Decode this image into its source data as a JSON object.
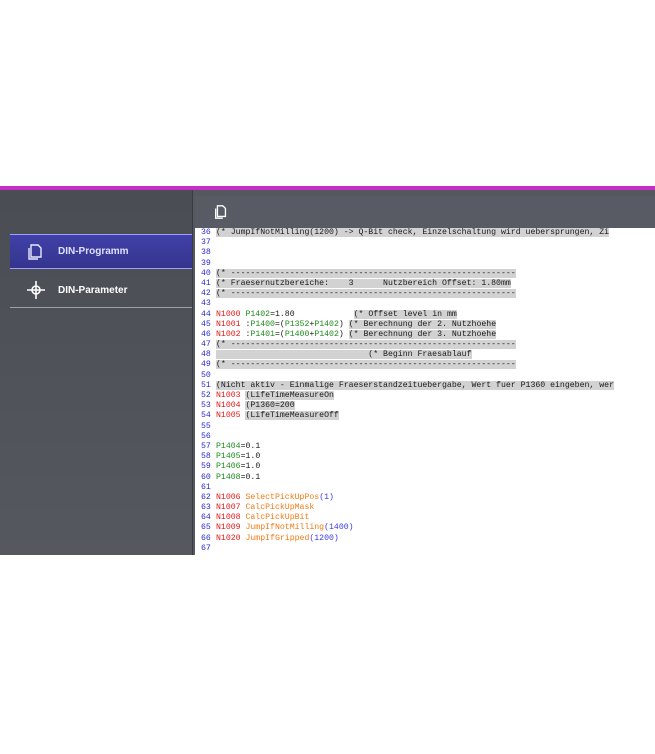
{
  "colors": {
    "accent": "#c62fc6",
    "sidebar_active": "#3b3b9e",
    "red": "#e01919",
    "green": "#1c8c1c",
    "orange": "#f07a12",
    "blue": "#3a3ae0"
  },
  "sidebar": {
    "items": [
      {
        "label": "DIN-Programm",
        "icon": "copy-document-icon",
        "active": true
      },
      {
        "label": "DIN-Parameter",
        "icon": "crosshair-icon",
        "active": false
      }
    ]
  },
  "toolbar": {
    "icon": "copy-document-icon"
  },
  "code": {
    "lines": [
      {
        "n": "36",
        "hl": true,
        "segs": [
          {
            "t": "(* JumpIfNotMilling(1200) -> Q-Bit check, Einzelschaltung wird uebersprungen, Zi"
          }
        ]
      },
      {
        "n": "37",
        "hl": false,
        "segs": []
      },
      {
        "n": "38",
        "hl": false,
        "segs": []
      },
      {
        "n": "39",
        "hl": false,
        "segs": []
      },
      {
        "n": "40",
        "hl": true,
        "segs": [
          {
            "t": "(* ----------------------------------------------------------"
          }
        ]
      },
      {
        "n": "41",
        "hl": true,
        "segs": [
          {
            "t": "(* Fraesernutzbereiche:    3      Nutzbereich Offset: 1.80mm"
          }
        ]
      },
      {
        "n": "42",
        "hl": true,
        "segs": [
          {
            "t": "(* ----------------------------------------------------------"
          }
        ]
      },
      {
        "n": "43",
        "hl": false,
        "segs": []
      },
      {
        "n": "44",
        "hl": false,
        "segs": [
          {
            "t": "N1000 ",
            "c": "red"
          },
          {
            "t": "P1402",
            "c": "green"
          },
          {
            "t": "=1.80            "
          },
          {
            "t": "(* Offset level in mm",
            "hl": true
          }
        ]
      },
      {
        "n": "45",
        "hl": false,
        "segs": [
          {
            "t": "N1001 ",
            "c": "red"
          },
          {
            "t": ":"
          },
          {
            "t": "P1400",
            "c": "green"
          },
          {
            "t": "=("
          },
          {
            "t": "P1352",
            "c": "green"
          },
          {
            "t": "+"
          },
          {
            "t": "P1402",
            "c": "green"
          },
          {
            "t": ") "
          },
          {
            "t": "(* Berechnung der 2. Nutzhoehe",
            "hl": true
          }
        ]
      },
      {
        "n": "46",
        "hl": false,
        "segs": [
          {
            "t": "N1002 ",
            "c": "red"
          },
          {
            "t": ":"
          },
          {
            "t": "P1401",
            "c": "green"
          },
          {
            "t": "=("
          },
          {
            "t": "P1400",
            "c": "green"
          },
          {
            "t": "+"
          },
          {
            "t": "P1402",
            "c": "green"
          },
          {
            "t": ") "
          },
          {
            "t": "(* Berechnung der 3. Nutzhoehe",
            "hl": true
          }
        ]
      },
      {
        "n": "47",
        "hl": true,
        "segs": [
          {
            "t": "(* ----------------------------------------------------------"
          }
        ]
      },
      {
        "n": "48",
        "hl": true,
        "segs": [
          {
            "t": "                               (* Beginn Fraesablauf"
          }
        ]
      },
      {
        "n": "49",
        "hl": true,
        "segs": [
          {
            "t": "(* ----------------------------------------------------------"
          }
        ]
      },
      {
        "n": "50",
        "hl": false,
        "segs": []
      },
      {
        "n": "51",
        "hl": true,
        "segs": [
          {
            "t": "(Nicht aktiv - Einmalige Fraeserstandzeituebergabe, Wert fuer P1360 eingeben, wer"
          }
        ]
      },
      {
        "n": "52",
        "hl": false,
        "segs": [
          {
            "t": "N1003 ",
            "c": "red"
          },
          {
            "t": "(LifeTimeMeasureOn",
            "hl": true
          }
        ]
      },
      {
        "n": "53",
        "hl": false,
        "segs": [
          {
            "t": "N1004 ",
            "c": "red"
          },
          {
            "t": "(P1360=200",
            "hl": true
          }
        ]
      },
      {
        "n": "54",
        "hl": false,
        "segs": [
          {
            "t": "N1005 ",
            "c": "red"
          },
          {
            "t": "(LifeTimeMeasureOff",
            "hl": true
          }
        ]
      },
      {
        "n": "55",
        "hl": false,
        "segs": []
      },
      {
        "n": "56",
        "hl": false,
        "segs": []
      },
      {
        "n": "57",
        "hl": false,
        "segs": [
          {
            "t": "P1404",
            "c": "green"
          },
          {
            "t": "=0.1"
          }
        ]
      },
      {
        "n": "58",
        "hl": false,
        "segs": [
          {
            "t": "P1405",
            "c": "green"
          },
          {
            "t": "=1.0"
          }
        ]
      },
      {
        "n": "59",
        "hl": false,
        "segs": [
          {
            "t": "P1406",
            "c": "green"
          },
          {
            "t": "=1.0"
          }
        ]
      },
      {
        "n": "60",
        "hl": false,
        "segs": [
          {
            "t": "P1408",
            "c": "green"
          },
          {
            "t": "=0.1"
          }
        ]
      },
      {
        "n": "61",
        "hl": false,
        "segs": []
      },
      {
        "n": "62",
        "hl": false,
        "segs": [
          {
            "t": "N1006 ",
            "c": "red"
          },
          {
            "t": "SelectPickUpPos",
            "c": "orange"
          },
          {
            "t": "(1)",
            "c": "blue"
          }
        ]
      },
      {
        "n": "63",
        "hl": false,
        "segs": [
          {
            "t": "N1007 ",
            "c": "red"
          },
          {
            "t": "CalcPickUpMask",
            "c": "orange"
          }
        ]
      },
      {
        "n": "64",
        "hl": false,
        "segs": [
          {
            "t": "N1008 ",
            "c": "red"
          },
          {
            "t": "CalcPickUpBit",
            "c": "orange"
          }
        ]
      },
      {
        "n": "65",
        "hl": false,
        "segs": [
          {
            "t": "N1009 ",
            "c": "red"
          },
          {
            "t": "JumpIfNotMilling",
            "c": "orange"
          },
          {
            "t": "(1400)",
            "c": "blue"
          }
        ]
      },
      {
        "n": "66",
        "hl": false,
        "segs": [
          {
            "t": "N1020 ",
            "c": "red"
          },
          {
            "t": "JumpIfGripped",
            "c": "orange"
          },
          {
            "t": "(1200)",
            "c": "blue"
          }
        ]
      },
      {
        "n": "67",
        "hl": false,
        "segs": []
      }
    ]
  }
}
